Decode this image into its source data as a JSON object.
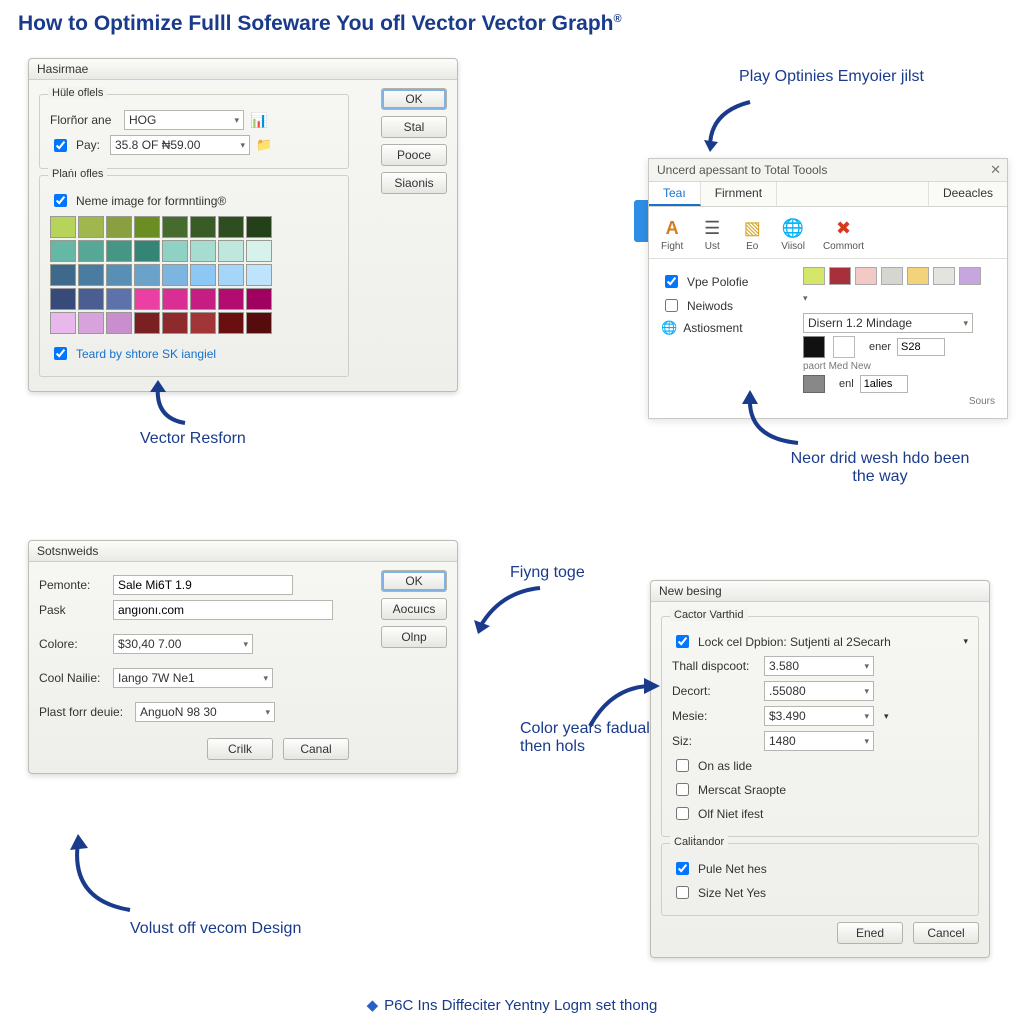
{
  "page": {
    "title_main": "How to Optimize Fulll Sofeware You ofl Vector Vector Graph",
    "title_mark": "®"
  },
  "annotations": {
    "a1": "Play Optinies Emyoier jilst",
    "a2": "Vector Resforn",
    "a3": "Neor drid wesh hdo been the way",
    "a4": "Fiyng toge",
    "a5": "Color years fadual then hols",
    "a6": "Volust off vecom Design",
    "footer": "P6C Ins Diffeciter Yentny Logm set thong"
  },
  "dlg1": {
    "title": "Hasirmae",
    "group1_legend": "Hüle oflels",
    "floron_label": "Florñor ane",
    "floron_value": "HOG",
    "pay_label": "Pay:",
    "pay_value": "35.8 OF ₦59.00",
    "group2_legend": "Plaṅı ofles",
    "neme_label": "Neme image for formntiing®",
    "teard_label": "Teard by shtore SK iangiel",
    "buttons": {
      "ok": "OK",
      "stal": "Stal",
      "pooce": "Pooce",
      "sitonis": "Siaonis"
    },
    "palette_colors": [
      "#b6d35a",
      "#9fb74d",
      "#8aa040",
      "#6b8e23",
      "#476b2e",
      "#395c27",
      "#2e4d20",
      "#24401a",
      "#66b7a6",
      "#56a796",
      "#459685",
      "#348575",
      "#8fd1c4",
      "#a7dcd1",
      "#bfe7de",
      "#d7f2eb",
      "#3d6a8a",
      "#497ca0",
      "#5a8fb5",
      "#6ba2ca",
      "#7cb5df",
      "#8dc8f4",
      "#a5d6f8",
      "#bde4fc",
      "#374a7a",
      "#4a5e92",
      "#5d72aa",
      "#ec3fa4",
      "#d92e93",
      "#c61d82",
      "#b30c71",
      "#a00060",
      "#e8b8ec",
      "#d8a3dd",
      "#c88ece",
      "#7a1f22",
      "#8e2a2d",
      "#a23538",
      "#6a0e10",
      "#560b0d"
    ]
  },
  "panel2": {
    "title": "Uncerd apessant to Total Toools",
    "tabs": {
      "t1": "Teaı",
      "t2": "Firnment",
      "t3": "Deeacles"
    },
    "ribbon": {
      "r1": "Fight",
      "r2": "Ust",
      "r3": "Eo",
      "r4": "Viisol",
      "r5": "Commort"
    },
    "left": {
      "c1": "Vpe Polofie",
      "c2": "Neiwods",
      "c3": "Astiosment"
    },
    "combo": "Disern 1.2 Mindage",
    "lbl_ener": "ener",
    "val_ener": "S28",
    "lbl_med": "paort Med New",
    "lbl_enl": "enl",
    "val_enl": "1alies",
    "lbl_sours": "Sours",
    "mini_colors": [
      "#d6e66a",
      "#a8303a",
      "#f2c9c4",
      "#d6d6d0",
      "#f2d27a",
      "#e4e4de",
      "#c7a6e0"
    ]
  },
  "dlg3": {
    "title": "Sotsnweids",
    "labels": {
      "pemonte": "Pemonte:",
      "pask": "Pask",
      "colore": "Colore:",
      "cool": "Cool Nailie:",
      "plast": "Plast forr deuie:"
    },
    "values": {
      "pemonte": "Sale Mi6T 1.9",
      "pask": "angıonı.com",
      "colore": "$30,40 7.00",
      "cool": "Iango 7W Ne1",
      "plast": "AnguoN 98 30"
    },
    "buttons": {
      "ok": "OK",
      "acc": "Aocuıcs",
      "olnp": "Olnp",
      "crik": "Crilk",
      "canal": "Canal"
    }
  },
  "dlg4": {
    "title": "New besing",
    "group_legend": "Cactor Varthid",
    "lockcel": "Lock cel Dpbion: Sutjenti al 2Secarh",
    "labels": {
      "thall": "Thall dispcoot:",
      "decort": "Decort:",
      "mesie": "Mesie:",
      "size": "Siz:"
    },
    "values": {
      "thall": "3.580",
      "decort": ".55080",
      "mesie": "$3.490",
      "size": "1480"
    },
    "chk_on": "On as lide",
    "chk_merscat": "Merscat Sraopte",
    "chk_olf": "Olf Niet ifest",
    "group2_legend": "Caliṫandor",
    "chk_pule": "Pule Net hes",
    "chk_sizey": "Size Net Yes",
    "buttons": {
      "ened": "Ened",
      "cancel": "Cancel"
    }
  }
}
